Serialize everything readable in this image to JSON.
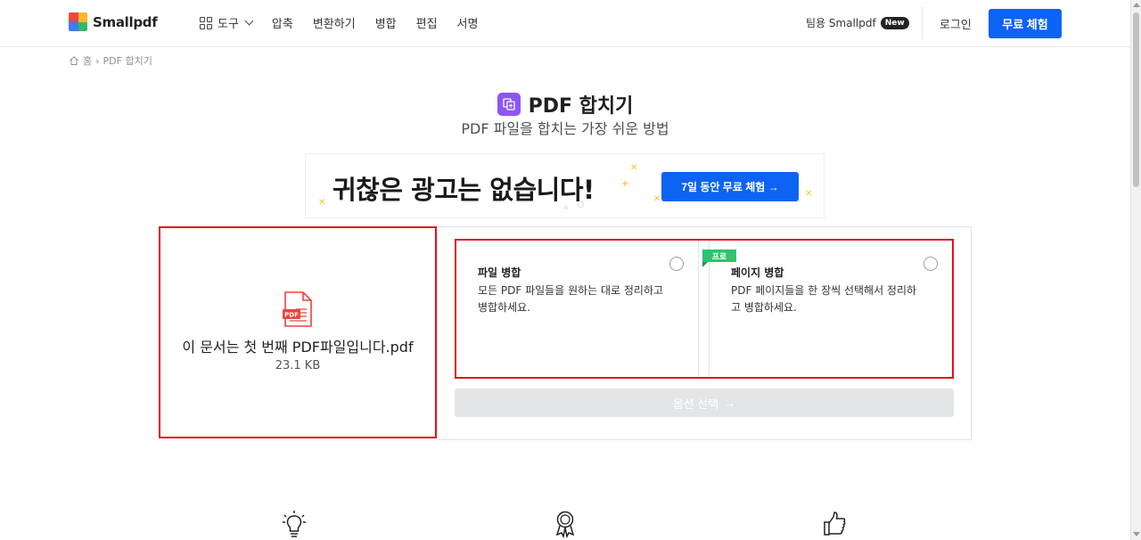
{
  "header": {
    "logo_text": "Smallpdf",
    "tools_label": "도구",
    "nav": [
      "압축",
      "변환하기",
      "병합",
      "편집",
      "서명"
    ],
    "team_label": "팀용 Smallpdf",
    "new_badge": "New",
    "login_label": "로그인",
    "trial_button": "무료 체험",
    "accent_color": "#0d63f3"
  },
  "breadcrumb": {
    "home": "홈",
    "separator": "›",
    "current": "PDF 합치기"
  },
  "page": {
    "title": "PDF 합치기",
    "subtitle": "PDF 파일을 합치는 가장 쉬운 방법",
    "tool_color": "#8c56f5"
  },
  "ad": {
    "headline": "귀찮은 광고는 없습니다!",
    "button_label": "7일 동안 무료 체험 →"
  },
  "file": {
    "name": "이 문서는 첫 번째 PDF파일입니다.pdf",
    "size": "23.1 KB",
    "icon_label": "PDF"
  },
  "options": [
    {
      "title": "파일 병합",
      "description": "모든 PDF 파일들을 원하는 대로 정리하고 병합하세요.",
      "selected": false
    },
    {
      "title": "페이지 병합",
      "description": "PDF 페이지들을 한 장씩 선택해서 정리하고 병합하세요.",
      "badge": "프로",
      "selected": false
    }
  ],
  "select_button": "옵션 선택",
  "select_arrow": "→",
  "features": [
    "lightbulb-icon",
    "award-icon",
    "thumbs-up-icon"
  ]
}
